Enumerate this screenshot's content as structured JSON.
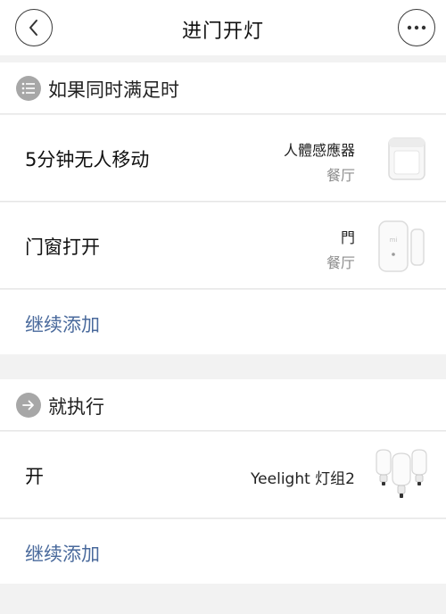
{
  "navbar": {
    "title": "进门开灯",
    "back_icon": "chevron-left-icon",
    "more_icon": "ellipsis-icon"
  },
  "condition": {
    "title": "如果同时满足时",
    "icon": "list-icon",
    "items": [
      {
        "label": "5分钟无人移动",
        "device": "人體感應器",
        "room": "餐厅",
        "image": "motion-sensor-image"
      },
      {
        "label": "门窗打开",
        "device": "門",
        "room": "餐厅",
        "image": "door-window-sensor-image"
      }
    ],
    "add_label": "继续添加"
  },
  "action": {
    "title": "就执行",
    "icon": "arrow-right-icon",
    "items": [
      {
        "label": "开",
        "device": "Yeelight 灯组2",
        "image": "bulb-group-image"
      }
    ],
    "add_label": "继续添加"
  },
  "colors": {
    "link": "#4a6a9c",
    "icon_bg": "#a7a7a7",
    "page_bg": "#f2f2f2"
  }
}
